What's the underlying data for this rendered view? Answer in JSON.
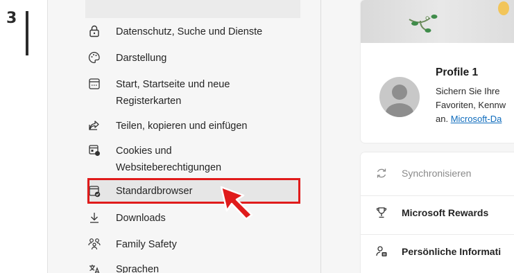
{
  "step": {
    "number": "3"
  },
  "sidebar": {
    "items": [
      {
        "label": "Datenschutz, Suche und Dienste",
        "icon": "lock-icon"
      },
      {
        "label": "Darstellung",
        "icon": "palette-icon"
      },
      {
        "label": "Start, Startseite und neue",
        "label2": "Registerkarten",
        "icon": "power-tab-icon"
      },
      {
        "label": "Teilen, kopieren und einfügen",
        "icon": "share-icon"
      },
      {
        "label": "Cookies und",
        "label2": "Websiteberechtigungen",
        "icon": "cookies-icon"
      },
      {
        "label": "Standardbrowser",
        "icon": "default-browser-icon"
      },
      {
        "label": "Downloads",
        "icon": "download-icon"
      },
      {
        "label": "Family Safety",
        "icon": "family-icon"
      },
      {
        "label": "Sprachen",
        "icon": "language-icon"
      }
    ],
    "active_item": "Standardbrowser"
  },
  "profile": {
    "name": "Profile 1",
    "desc_line1": "Sichern Sie Ihre",
    "desc_line2": "Favoriten, Kennw",
    "desc_line3_prefix": "an. ",
    "desc_link": "Microsoft-Da"
  },
  "profile_list": {
    "items": [
      {
        "label": "Synchronisieren",
        "icon": "sync-icon",
        "dimmed": true
      },
      {
        "label": "Microsoft Rewards",
        "icon": "trophy-icon",
        "dimmed": false
      },
      {
        "label": "Persönliche Informati",
        "icon": "personal-info-icon",
        "dimmed": false
      }
    ]
  },
  "colors": {
    "highlight": "#e01b1b",
    "link": "#0f6cbd"
  }
}
